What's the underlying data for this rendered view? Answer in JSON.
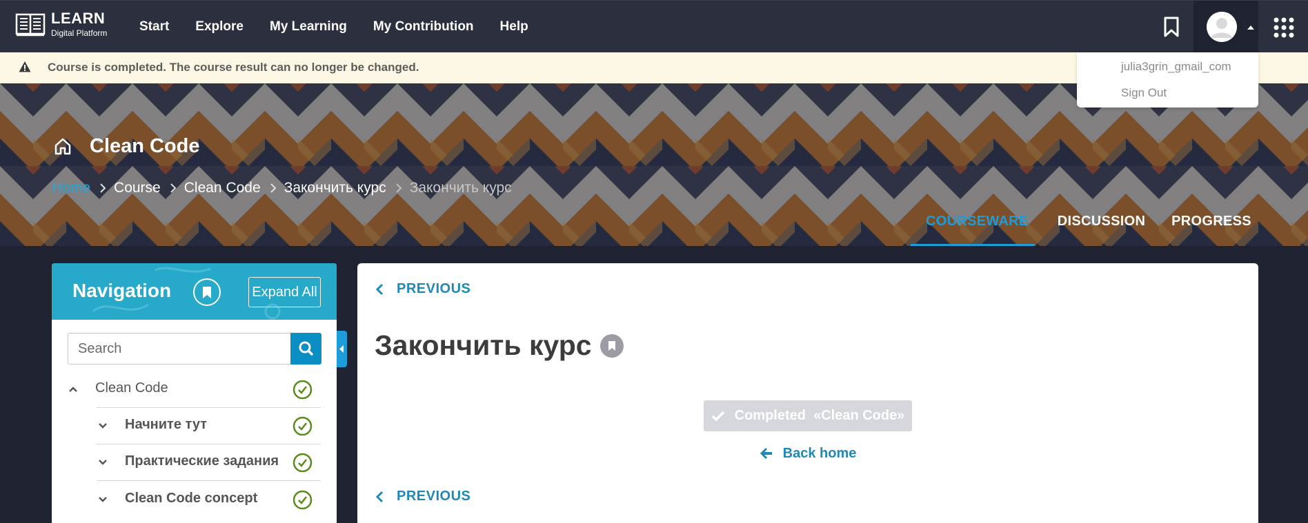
{
  "brand": {
    "title": "LEARN",
    "subtitle": "Digital Platform"
  },
  "nav": {
    "items": [
      "Start",
      "Explore",
      "My Learning",
      "My Contribution",
      "Help"
    ]
  },
  "user_menu": {
    "username": "julia3grin_gmail_com",
    "sign_out": "Sign Out"
  },
  "banner": {
    "text": "Course is completed. The course result can no longer be changed."
  },
  "hero": {
    "course_title": "Clean Code",
    "breadcrumb": [
      "Home",
      "Course",
      "Clean Code",
      "Закончить курс",
      "Закончить курс"
    ],
    "tabs": [
      "COURSEWARE",
      "DISCUSSION",
      "PROGRESS"
    ],
    "active_tab": "COURSEWARE"
  },
  "sidebar": {
    "title": "Navigation",
    "expand_label": "Expand All",
    "search_placeholder": "Search",
    "outline": [
      {
        "label": "Clean Code",
        "expanded": true,
        "completed": true
      },
      {
        "label": "Начните тут",
        "expanded": false,
        "completed": true
      },
      {
        "label": "Практические задания",
        "expanded": false,
        "completed": true
      },
      {
        "label": "Clean Code concept",
        "expanded": false,
        "completed": true
      }
    ]
  },
  "main": {
    "previous_label": "PREVIOUS",
    "unit_title": "Закончить курс",
    "completed_label": "Completed  «Clean Code»",
    "back_home_label": "Back home"
  },
  "colors": {
    "topbar": "#2c2f3d",
    "accent": "#1e9cd7",
    "banner_bg": "#fdf8e5",
    "check_green": "#5a8a1a",
    "sidebar_header": "#27a9c9"
  }
}
